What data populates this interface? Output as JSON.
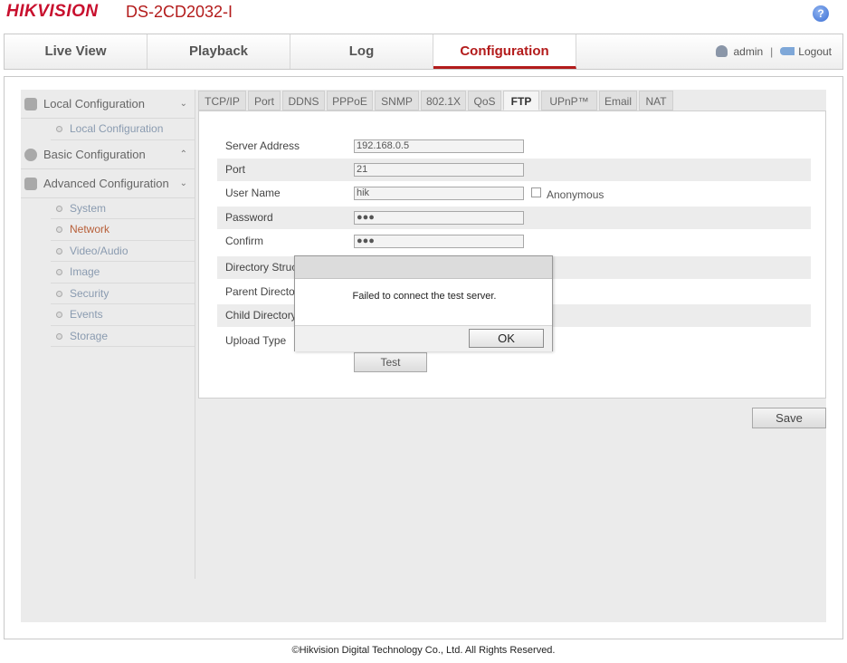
{
  "header": {
    "brand": "HIKVISION",
    "model": "DS-2CD2032-I",
    "help_glyph": "?"
  },
  "nav": {
    "tabs": [
      {
        "label": "Live View"
      },
      {
        "label": "Playback"
      },
      {
        "label": "Log"
      },
      {
        "label": "Configuration",
        "active": true
      }
    ],
    "user": "admin",
    "separator": "|",
    "logout": "Logout"
  },
  "sidebar": {
    "local_configuration": {
      "label": "Local Configuration",
      "items": [
        "Local Configuration"
      ]
    },
    "basic_configuration": {
      "label": "Basic Configuration"
    },
    "advanced_configuration": {
      "label": "Advanced Configuration",
      "items": [
        "System",
        "Network",
        "Video/Audio",
        "Image",
        "Security",
        "Events",
        "Storage"
      ],
      "active": "Network"
    },
    "chevron_down": "⌄",
    "chevron_up": "⌃"
  },
  "tabs": [
    "TCP/IP",
    "Port",
    "DDNS",
    "PPPoE",
    "SNMP",
    "802.1X",
    "QoS",
    "FTP",
    "UPnP™",
    "Email",
    "NAT"
  ],
  "active_tab": "FTP",
  "form": {
    "server_address": {
      "label": "Server Address",
      "value": "192.168.0.5"
    },
    "port": {
      "label": "Port",
      "value": "21"
    },
    "user_name": {
      "label": "User Name",
      "value": "hik"
    },
    "anonymous": {
      "label": "Anonymous",
      "checked": false
    },
    "password": {
      "label": "Password",
      "value": "●●●"
    },
    "confirm": {
      "label": "Confirm",
      "value": "●●●"
    },
    "directory_structure": {
      "label": "Directory Struct"
    },
    "parent_directory": {
      "label": "Parent Director"
    },
    "child_directory": {
      "label": "Child Directory"
    },
    "upload_type": {
      "label": "Upload Type"
    },
    "test_button": "Test"
  },
  "save_button": "Save",
  "dialog": {
    "message": "Failed to connect the test server.",
    "ok_button": "OK"
  },
  "footer": "©Hikvision Digital Technology Co., Ltd. All Rights Reserved."
}
